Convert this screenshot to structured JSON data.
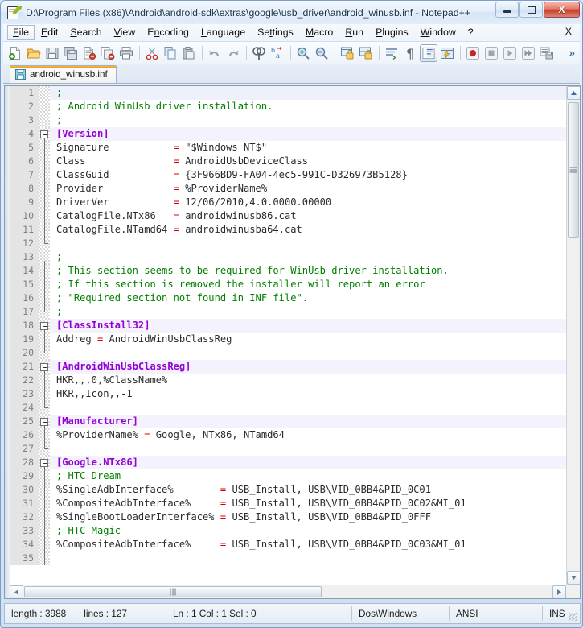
{
  "window": {
    "title": "D:\\Program Files (x86)\\Android\\android-sdk\\extras\\google\\usb_driver\\android_winusb.inf - Notepad++",
    "app_icon": "notepad-pencil-icon",
    "minimize_label": "–",
    "maximize_label": "❐",
    "close_label": "X"
  },
  "menubar": {
    "items": [
      {
        "label": "File",
        "accel": "F",
        "active": true
      },
      {
        "label": "Edit",
        "accel": "E",
        "active": false
      },
      {
        "label": "Search",
        "accel": "S",
        "active": false
      },
      {
        "label": "View",
        "accel": "V",
        "active": false
      },
      {
        "label": "Encoding",
        "accel": "n",
        "active": false
      },
      {
        "label": "Language",
        "accel": "L",
        "active": false
      },
      {
        "label": "Settings",
        "accel": "t",
        "active": false
      },
      {
        "label": "Macro",
        "accel": "M",
        "active": false
      },
      {
        "label": "Run",
        "accel": "R",
        "active": false
      },
      {
        "label": "Plugins",
        "accel": "P",
        "active": false
      },
      {
        "label": "Window",
        "accel": "W",
        "active": false
      },
      {
        "label": "?",
        "accel": "",
        "active": false
      }
    ],
    "close_document_label": "X"
  },
  "toolbar": {
    "buttons": [
      {
        "name": "new-file-icon",
        "title": "New"
      },
      {
        "name": "open-file-icon",
        "title": "Open"
      },
      {
        "name": "save-icon",
        "title": "Save"
      },
      {
        "name": "save-all-icon",
        "title": "Save All"
      },
      {
        "name": "close-file-icon",
        "title": "Close"
      },
      {
        "name": "close-all-icon",
        "title": "Close All"
      },
      {
        "name": "print-icon",
        "title": "Print"
      },
      {
        "name": "cut-icon",
        "title": "Cut"
      },
      {
        "name": "copy-icon",
        "title": "Copy"
      },
      {
        "name": "paste-icon",
        "title": "Paste"
      },
      {
        "name": "undo-icon",
        "title": "Undo"
      },
      {
        "name": "redo-icon",
        "title": "Redo"
      },
      {
        "name": "find-icon",
        "title": "Find"
      },
      {
        "name": "replace-icon",
        "title": "Replace"
      },
      {
        "name": "zoom-in-icon",
        "title": "Zoom In"
      },
      {
        "name": "zoom-out-icon",
        "title": "Zoom Out"
      },
      {
        "name": "sync-vertical-scroll-icon",
        "title": "Synchronize Vertical Scrolling"
      },
      {
        "name": "sync-horizontal-scroll-icon",
        "title": "Synchronize Horizontal Scrolling"
      },
      {
        "name": "word-wrap-icon",
        "title": "Word Wrap"
      },
      {
        "name": "show-all-characters-icon",
        "title": "Show All Characters"
      },
      {
        "name": "indent-guide-icon",
        "title": "Show Indent Guide",
        "active": true
      },
      {
        "name": "user-defined-dialog-icon",
        "title": "User Defined Dialogue"
      },
      {
        "name": "macro-record-icon",
        "title": "Start Recording"
      },
      {
        "name": "macro-stop-icon",
        "title": "Stop Recording"
      },
      {
        "name": "macro-play-icon",
        "title": "Playback"
      },
      {
        "name": "macro-multi-play-icon",
        "title": "Run a Macro Multiple Times"
      },
      {
        "name": "macro-save-icon",
        "title": "Save Current Recorded Macro"
      }
    ],
    "overflow_label": "»"
  },
  "tabs": [
    {
      "label": "android_winusb.inf",
      "icon": "save-state-icon",
      "active": true
    }
  ],
  "editor": {
    "first_visible_line": 1,
    "current_line": 1,
    "lines": [
      {
        "n": 1,
        "fold": "none",
        "hl": true,
        "tokens": [
          {
            "t": ";",
            "c": "com"
          }
        ]
      },
      {
        "n": 2,
        "fold": "none",
        "tokens": [
          {
            "t": "; Android WinUsb driver installation.",
            "c": "com"
          }
        ]
      },
      {
        "n": 3,
        "fold": "none",
        "tokens": [
          {
            "t": ";",
            "c": "com"
          }
        ]
      },
      {
        "n": 4,
        "fold": "head",
        "sect": true,
        "tokens": [
          {
            "t": "[Version]",
            "c": "sect"
          }
        ]
      },
      {
        "n": 5,
        "fold": "body",
        "tokens": [
          {
            "t": "Signature           ",
            "c": "key"
          },
          {
            "t": "= ",
            "c": "eq"
          },
          {
            "t": "\"$Windows NT$\"",
            "c": "val"
          }
        ]
      },
      {
        "n": 6,
        "fold": "body",
        "tokens": [
          {
            "t": "Class               ",
            "c": "key"
          },
          {
            "t": "= ",
            "c": "eq"
          },
          {
            "t": "AndroidUsbDeviceClass",
            "c": "val"
          }
        ]
      },
      {
        "n": 7,
        "fold": "body",
        "tokens": [
          {
            "t": "ClassGuid           ",
            "c": "key"
          },
          {
            "t": "= ",
            "c": "eq"
          },
          {
            "t": "{3F966BD9-FA04-4ec5-991C-D326973B5128}",
            "c": "val"
          }
        ]
      },
      {
        "n": 8,
        "fold": "body",
        "tokens": [
          {
            "t": "Provider            ",
            "c": "key"
          },
          {
            "t": "= ",
            "c": "eq"
          },
          {
            "t": "%ProviderName%",
            "c": "val"
          }
        ]
      },
      {
        "n": 9,
        "fold": "body",
        "tokens": [
          {
            "t": "DriverVer           ",
            "c": "key"
          },
          {
            "t": "= ",
            "c": "eq"
          },
          {
            "t": "12/06/2010,4.0.0000.00000",
            "c": "val"
          }
        ]
      },
      {
        "n": 10,
        "fold": "body",
        "tokens": [
          {
            "t": "CatalogFile.NTx86   ",
            "c": "key"
          },
          {
            "t": "= ",
            "c": "eq"
          },
          {
            "t": "androidwinusb86.cat",
            "c": "val"
          }
        ]
      },
      {
        "n": 11,
        "fold": "body",
        "tokens": [
          {
            "t": "CatalogFile.NTamd64 ",
            "c": "key"
          },
          {
            "t": "= ",
            "c": "eq"
          },
          {
            "t": "androidwinusba64.cat",
            "c": "val"
          }
        ]
      },
      {
        "n": 12,
        "fold": "tail",
        "tokens": []
      },
      {
        "n": 13,
        "fold": "head-plain",
        "tokens": [
          {
            "t": ";",
            "c": "com"
          }
        ]
      },
      {
        "n": 14,
        "fold": "body",
        "tokens": [
          {
            "t": "; This section seems to be required for WinUsb driver installation.",
            "c": "com"
          }
        ]
      },
      {
        "n": 15,
        "fold": "body",
        "tokens": [
          {
            "t": "; If this section is removed the installer will report an error",
            "c": "com"
          }
        ]
      },
      {
        "n": 16,
        "fold": "body",
        "tokens": [
          {
            "t": "; \"Required section not found in INF file\".",
            "c": "com"
          }
        ]
      },
      {
        "n": 17,
        "fold": "tail",
        "tokens": [
          {
            "t": ";",
            "c": "com"
          }
        ]
      },
      {
        "n": 18,
        "fold": "head",
        "sect": true,
        "tokens": [
          {
            "t": "[ClassInstall32]",
            "c": "sect"
          }
        ]
      },
      {
        "n": 19,
        "fold": "body",
        "tokens": [
          {
            "t": "Addreg ",
            "c": "key"
          },
          {
            "t": "= ",
            "c": "eq"
          },
          {
            "t": "AndroidWinUsbClassReg",
            "c": "val"
          }
        ]
      },
      {
        "n": 20,
        "fold": "tail",
        "tokens": []
      },
      {
        "n": 21,
        "fold": "head",
        "sect": true,
        "tokens": [
          {
            "t": "[AndroidWinUsbClassReg]",
            "c": "sect"
          }
        ]
      },
      {
        "n": 22,
        "fold": "body",
        "tokens": [
          {
            "t": "HKR,,,0,%ClassName%",
            "c": "key"
          }
        ]
      },
      {
        "n": 23,
        "fold": "body",
        "tokens": [
          {
            "t": "HKR,,Icon,,-1",
            "c": "key"
          }
        ]
      },
      {
        "n": 24,
        "fold": "tail",
        "tokens": []
      },
      {
        "n": 25,
        "fold": "head",
        "sect": true,
        "tokens": [
          {
            "t": "[Manufacturer]",
            "c": "sect"
          }
        ]
      },
      {
        "n": 26,
        "fold": "body",
        "tokens": [
          {
            "t": "%ProviderName% ",
            "c": "key"
          },
          {
            "t": "= ",
            "c": "eq"
          },
          {
            "t": "Google, NTx86, NTamd64",
            "c": "val"
          }
        ]
      },
      {
        "n": 27,
        "fold": "tail",
        "tokens": []
      },
      {
        "n": 28,
        "fold": "head",
        "sect": true,
        "tokens": [
          {
            "t": "[Google.NTx86]",
            "c": "sect"
          }
        ]
      },
      {
        "n": 29,
        "fold": "body",
        "tokens": [
          {
            "t": "; HTC Dream",
            "c": "com"
          }
        ]
      },
      {
        "n": 30,
        "fold": "body",
        "tokens": [
          {
            "t": "%SingleAdbInterface%        ",
            "c": "key"
          },
          {
            "t": "= ",
            "c": "eq"
          },
          {
            "t": "USB_Install, USB\\VID_0BB4&PID_0C01",
            "c": "val"
          }
        ]
      },
      {
        "n": 31,
        "fold": "body",
        "tokens": [
          {
            "t": "%CompositeAdbInterface%     ",
            "c": "key"
          },
          {
            "t": "= ",
            "c": "eq"
          },
          {
            "t": "USB_Install, USB\\VID_0BB4&PID_0C02&MI_01",
            "c": "val"
          }
        ]
      },
      {
        "n": 32,
        "fold": "body",
        "tokens": [
          {
            "t": "%SingleBootLoaderInterface% ",
            "c": "key"
          },
          {
            "t": "= ",
            "c": "eq"
          },
          {
            "t": "USB_Install, USB\\VID_0BB4&PID_0FFF",
            "c": "val"
          }
        ]
      },
      {
        "n": 33,
        "fold": "body",
        "tokens": [
          {
            "t": "; HTC Magic",
            "c": "com"
          }
        ]
      },
      {
        "n": 34,
        "fold": "body",
        "tokens": [
          {
            "t": "%CompositeAdbInterface%     ",
            "c": "key"
          },
          {
            "t": "= ",
            "c": "eq"
          },
          {
            "t": "USB_Install, USB\\VID_0BB4&PID_0C03&MI_01",
            "c": "val"
          }
        ]
      },
      {
        "n": 35,
        "fold": "body",
        "tokens": []
      }
    ]
  },
  "statusbar": {
    "length_label": "length : 3988",
    "lines_label": "lines : 127",
    "position_label": "Ln : 1    Col : 1    Sel : 0",
    "eol_label": "Dos\\Windows",
    "encoding_label": "ANSI",
    "insert_mode_label": "INS"
  },
  "colors": {
    "comment": "#008000",
    "section": "#9400d3",
    "operator": "#d40000",
    "text": "#2b2b2b",
    "tab_accent": "#f08a12",
    "close_button": "#c33b28"
  }
}
